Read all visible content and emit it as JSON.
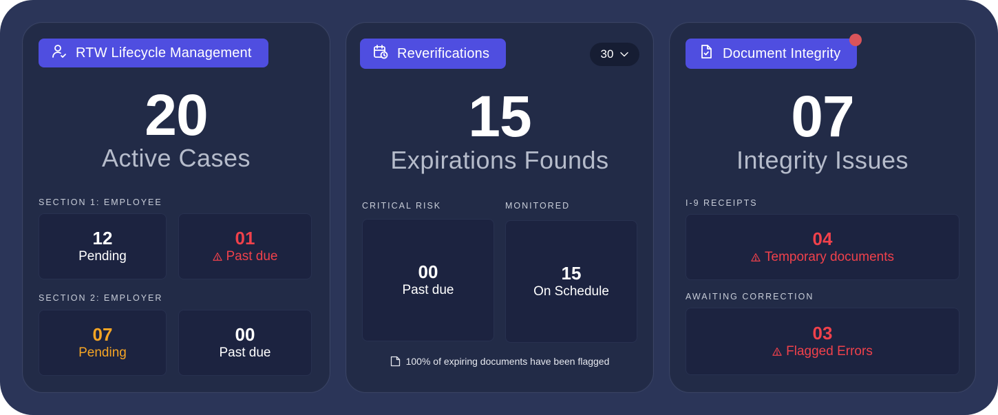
{
  "colors": {
    "accent": "#4f4ee0",
    "danger": "#f0414b",
    "warning": "#f5a524",
    "background": "#2b3558",
    "card": "#222b47"
  },
  "rtw": {
    "title": "RTW Lifecycle Management",
    "icon": "user-check-icon",
    "count": "20",
    "subtitle": "Active Cases",
    "section1_label": "SECTION 1: EMPLOYEE",
    "section1": [
      {
        "value": "12",
        "label": "Pending"
      },
      {
        "value": "01",
        "label": "Past due"
      }
    ],
    "section2_label": "SECTION 2: EMPLOYER",
    "section2": [
      {
        "value": "07",
        "label": "Pending"
      },
      {
        "value": "00",
        "label": "Past due"
      }
    ]
  },
  "reverifications": {
    "title": "Reverifications",
    "icon": "calendar-clock-icon",
    "period": "30",
    "count": "15",
    "subtitle": "Expirations Founds",
    "critical_label": "CRITICAL RISK",
    "monitored_label": "MONITORED",
    "critical": {
      "value": "00",
      "label": "Past due"
    },
    "monitored": {
      "value": "15",
      "label": "On Schedule"
    },
    "footnote": "100% of expiring documents have been flagged"
  },
  "integrity": {
    "title": "Document Integrity",
    "icon": "document-check-icon",
    "count": "07",
    "subtitle": "Integrity Issues",
    "receipts_label": "I-9 RECEIPTS",
    "receipts": {
      "value": "04",
      "label": "Temporary documents"
    },
    "correction_label": "AWAITING CORRECTION",
    "correction": {
      "value": "03",
      "label": "Flagged Errors"
    }
  }
}
